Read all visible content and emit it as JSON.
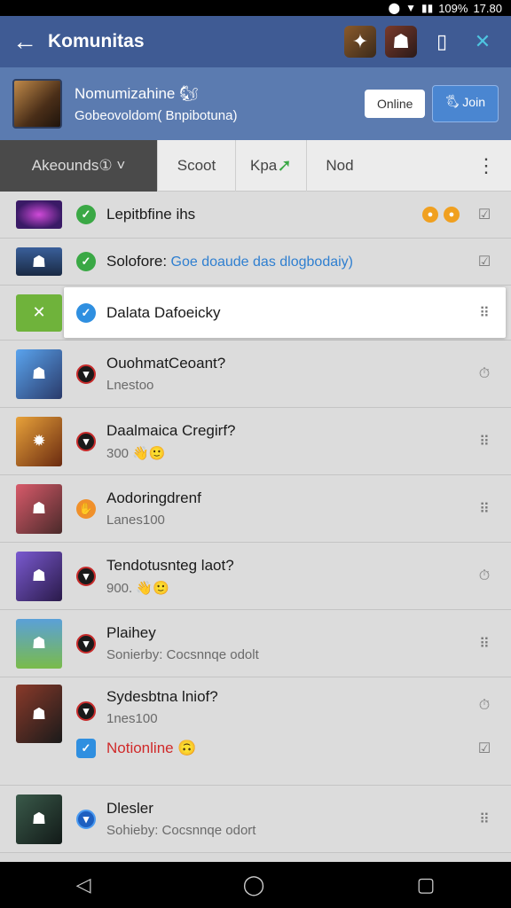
{
  "statusbar": {
    "battery": "109%",
    "time": "17.80"
  },
  "appbar": {
    "back_icon": "arrow-left-icon",
    "title": "Komunitas"
  },
  "header": {
    "name": "Nomumizahine 🐿",
    "subtitle": "Gobeovoldom( Bnpibotuna)",
    "online_label": "Online",
    "join_label": "🖏 Join"
  },
  "tabs": {
    "active": "Akeounds①",
    "t2": "Scoot",
    "t3": "Kpa",
    "t4": "Nod"
  },
  "rows": [
    {
      "name": "Lepitbfine ihs",
      "sub": ""
    },
    {
      "name": "Solofore:",
      "link": "Goe doaude das dlogbodaiy)"
    },
    {
      "name": "Dalata Dafoeicky"
    },
    {
      "name": "OuohmatCeoant?",
      "sub": "Lnestoo"
    },
    {
      "name": "Daalmaica Cregirf?",
      "sub": "300 👋🙂"
    },
    {
      "name": "Aodoringdrenf",
      "sub": "Lanes100"
    },
    {
      "name": "Tendotusnteg laot?",
      "sub": "900. 👋🙂"
    },
    {
      "name": "Plaihey",
      "sub": "Sonierby: Cocsnnqe odolt"
    },
    {
      "name": "Sydesbtna lniof?",
      "sub": "1nes100"
    },
    {
      "name": "Notionline 🙃"
    },
    {
      "name": "Dlesler",
      "sub": "Sohieby: Cocsnnqe odort"
    }
  ],
  "colors": {
    "appbar": "#3f5b94",
    "header": "#5b7bb0",
    "accent_blue": "#2f8fe0",
    "ok_green": "#3aa845"
  }
}
